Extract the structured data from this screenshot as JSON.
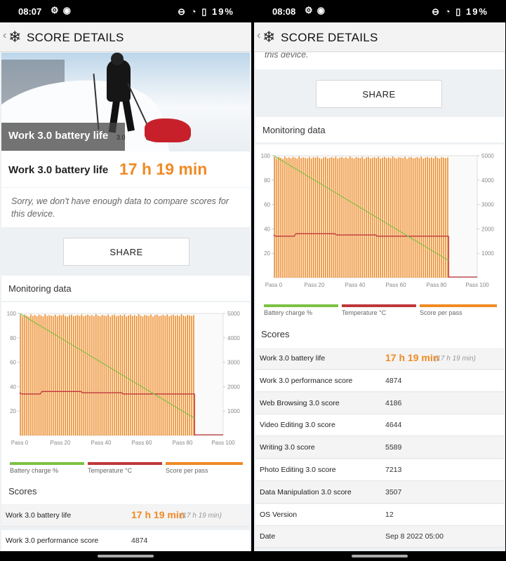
{
  "left": {
    "status": {
      "time": "08:07",
      "battery": "19%"
    },
    "appbar": {
      "title": "SCORE DETAILS"
    },
    "hero_label": "Work 3.0 battery life",
    "hero_badge": "3.0",
    "result": {
      "name": "Work 3.0 battery life",
      "value": "17 h 19 min"
    },
    "sorry_text": "Sorry, we don't have enough data to compare scores for this device.",
    "share_label": "SHARE",
    "monitoring_title": "Monitoring data",
    "scores_title": "Scores",
    "scores_rows": [
      {
        "label": "Work 3.0 battery life",
        "value": "17 h 19 min",
        "secondary": "(17 h 19 min)"
      },
      {
        "label": "Work 3.0 performance score",
        "value": "4874"
      }
    ]
  },
  "right": {
    "status": {
      "time": "08:08",
      "battery": "19%"
    },
    "appbar": {
      "title": "SCORE DETAILS"
    },
    "sorry_tail": "this device.",
    "share_label": "SHARE",
    "monitoring_title": "Monitoring data",
    "scores_title": "Scores",
    "scores_rows": [
      {
        "label": "Work 3.0 battery life",
        "value": "17 h 19 min",
        "secondary": "(17 h 19 min)"
      },
      {
        "label": "Work 3.0 performance score",
        "value": "4874"
      },
      {
        "label": "Web Browsing 3.0 score",
        "value": "4186"
      },
      {
        "label": "Video Editing 3.0 score",
        "value": "4644"
      },
      {
        "label": "Writing 3.0 score",
        "value": "5589"
      },
      {
        "label": "Photo Editing 3.0 score",
        "value": "7213"
      },
      {
        "label": "Data Manipulation 3.0 score",
        "value": "3507"
      },
      {
        "label": "OS Version",
        "value": "12"
      },
      {
        "label": "Date",
        "value": "Sep 8 2022 05:00"
      }
    ]
  },
  "icons": {
    "back": "chevron-left-icon",
    "logo": "snowflake-icon",
    "settings": "gear-icon",
    "notification": "dot-icon",
    "dnd": "do-not-disturb-icon",
    "wifi": "wifi-icon",
    "battery": "battery-icon"
  },
  "colors": {
    "accent": "#f08a24",
    "battery_line": "#7cc242",
    "temperature_line": "#c0373a",
    "score_bars": "#f08a24"
  },
  "chart_data": {
    "type": "bar",
    "x_ticks": [
      "Pass 0",
      "Pass 20",
      "Pass 40",
      "Pass 60",
      "Pass 80",
      "Pass 100"
    ],
    "y_left_ticks": [
      "100",
      "80",
      "60",
      "40",
      "20"
    ],
    "y_right_ticks": [
      "5000",
      "4000",
      "3000",
      "2000",
      "1000"
    ],
    "ylim_left": [
      0,
      100
    ],
    "ylim_right": [
      0,
      5000
    ],
    "xlim": [
      0,
      100
    ],
    "passes": 86,
    "series": [
      {
        "name": "Battery charge %",
        "type": "line",
        "color": "#7cc242",
        "x": [
          0,
          86
        ],
        "values": [
          100,
          14
        ]
      },
      {
        "name": "Temperature °C",
        "type": "line",
        "color": "#c0373a",
        "x": [
          0,
          1,
          2,
          3,
          10,
          11,
          30,
          31,
          50,
          51,
          86
        ],
        "values": [
          35,
          34,
          34,
          34,
          34,
          36,
          36,
          35,
          35,
          34,
          34
        ]
      },
      {
        "name": "Score per pass",
        "type": "bar",
        "color": "#f08a24",
        "axis": "right",
        "values": [
          4940,
          4880,
          4950,
          4910,
          4870,
          4960,
          4900,
          4930,
          4890,
          4950,
          4920,
          4880,
          4970,
          4900,
          4930,
          4910,
          4890,
          4950,
          4880,
          4940,
          4920,
          4960,
          4900,
          4870,
          4930,
          4950,
          4890,
          4910,
          4940,
          4900,
          4960,
          4880,
          4920,
          4950,
          4900,
          4930,
          4890,
          4970,
          4910,
          4880,
          4940,
          4920,
          4900,
          4960,
          4870,
          4930,
          4950,
          4890,
          4910,
          4940,
          4900,
          4960,
          4880,
          4920,
          4950,
          4900,
          4930,
          4890,
          4970,
          4910,
          4880,
          4940,
          4920,
          4900,
          4960,
          4870,
          4930,
          4950,
          4890,
          4910,
          4940,
          4900,
          4960,
          4880,
          4920,
          4950,
          4900,
          4930,
          4890,
          4970,
          4910,
          4880,
          4940,
          4920,
          4900,
          4930
        ]
      }
    ],
    "legend": [
      "Battery charge %",
      "Temperature °C",
      "Score per pass"
    ],
    "legend_position": "bottom"
  }
}
